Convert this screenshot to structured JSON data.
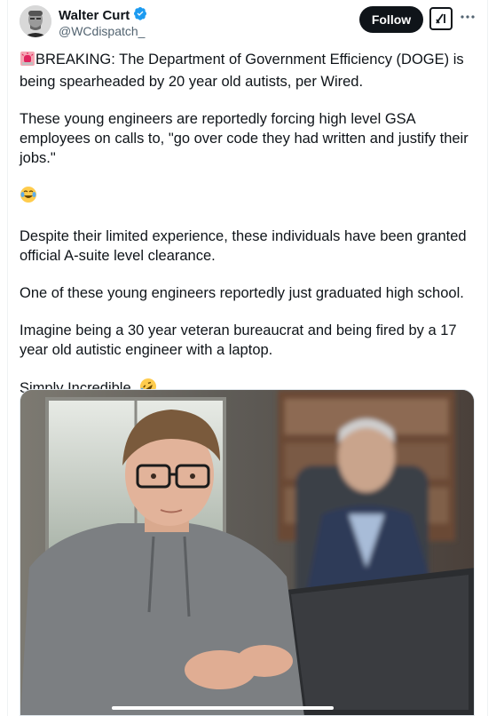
{
  "author": {
    "display_name": "Walter Curt",
    "handle": "@WCdispatch_",
    "verified": true
  },
  "actions": {
    "follow_label": "Follow"
  },
  "tweet": {
    "p1": "BREAKING: The Department of Government Efficiency (DOGE) is being spearheaded by 20 year old autists, per Wired.",
    "p2": "These young engineers are reportedly forcing high level GSA employees on calls to, \"go over code they had written and justify their jobs.\"",
    "p4": "Despite their limited experience, these individuals have been granted official A-suite level clearance.",
    "p5": "One of these young engineers reportedly just graduated high school.",
    "p6": "Imagine being a 30 year veteran bureaucrat and being fired by a 17 year old autistic engineer with a laptop.",
    "p7": "Simply Incredible."
  },
  "icons": {
    "siren": "rotating-light-icon",
    "tears_of_joy": "face-with-tears-of-joy-icon",
    "rofl": "rolling-on-floor-laughing-icon",
    "verified": "verified-badge-icon",
    "grok": "grok-icon",
    "more": "more-options-icon"
  },
  "colors": {
    "verified_blue": "#1d9bf0",
    "follow_bg": "#0f1419",
    "text_primary": "#0f1419",
    "text_secondary": "#536471",
    "siren_red": "#e0245e"
  }
}
